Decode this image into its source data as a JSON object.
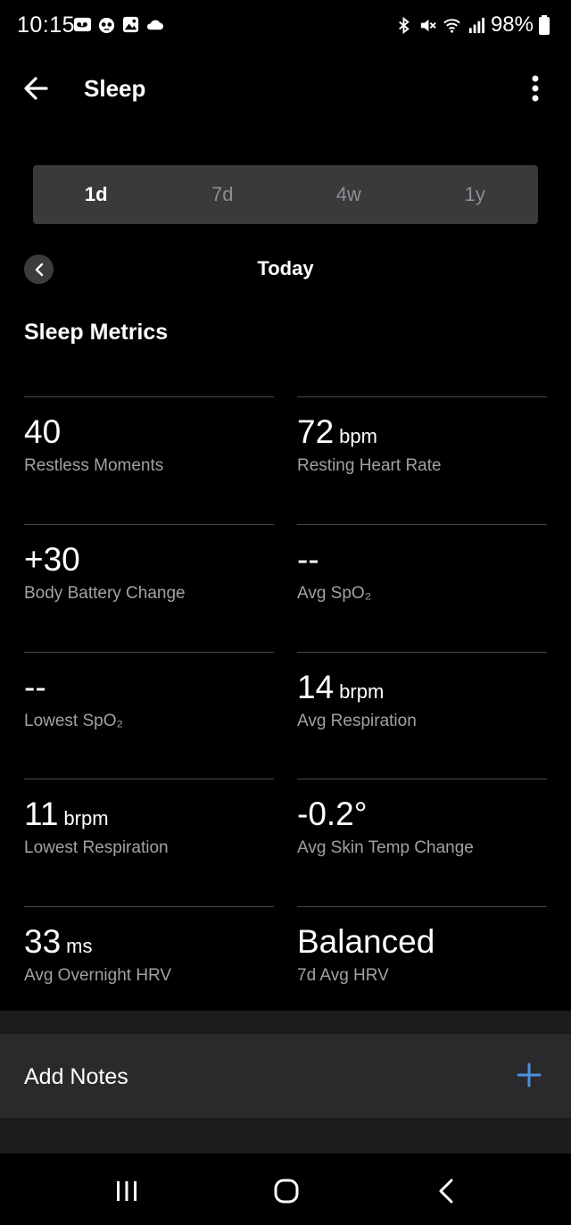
{
  "status_bar": {
    "time": "10:15",
    "battery": "98%",
    "left_icons": [
      "voicemail-icon",
      "cartoon-face-icon",
      "image-icon",
      "cloud-icon"
    ],
    "right_icons": [
      "bluetooth-icon",
      "mute-icon",
      "wifi-icon",
      "signal-icon",
      "battery-icon"
    ]
  },
  "app_bar": {
    "title": "Sleep"
  },
  "segments": [
    {
      "label": "1d",
      "active": true
    },
    {
      "label": "7d",
      "active": false
    },
    {
      "label": "4w",
      "active": false
    },
    {
      "label": "1y",
      "active": false
    }
  ],
  "date_nav": {
    "label": "Today"
  },
  "section_title": "Sleep Metrics",
  "metrics": [
    {
      "value": "40",
      "unit": "",
      "label": "Restless Moments"
    },
    {
      "value": "72",
      "unit": "bpm",
      "label": "Resting Heart Rate"
    },
    {
      "value": "+30",
      "unit": "",
      "label": "Body Battery Change"
    },
    {
      "value": "--",
      "unit": "",
      "label": "Avg SpO₂"
    },
    {
      "value": "--",
      "unit": "",
      "label": "Lowest SpO₂"
    },
    {
      "value": "14",
      "unit": "brpm",
      "label": "Avg Respiration"
    },
    {
      "value": "11",
      "unit": "brpm",
      "label": "Lowest Respiration"
    },
    {
      "value": "-0.2°",
      "unit": "",
      "label": "Avg Skin Temp Change"
    },
    {
      "value": "33",
      "unit": "ms",
      "label": "Avg Overnight HRV"
    },
    {
      "value": "Balanced",
      "unit": "",
      "label": "7d Avg HRV"
    }
  ],
  "notes": {
    "label": "Add Notes"
  },
  "colors": {
    "accent": "#4a90e2",
    "segment_bg": "#3a3a3c",
    "muted_text": "#a1a1a6"
  }
}
